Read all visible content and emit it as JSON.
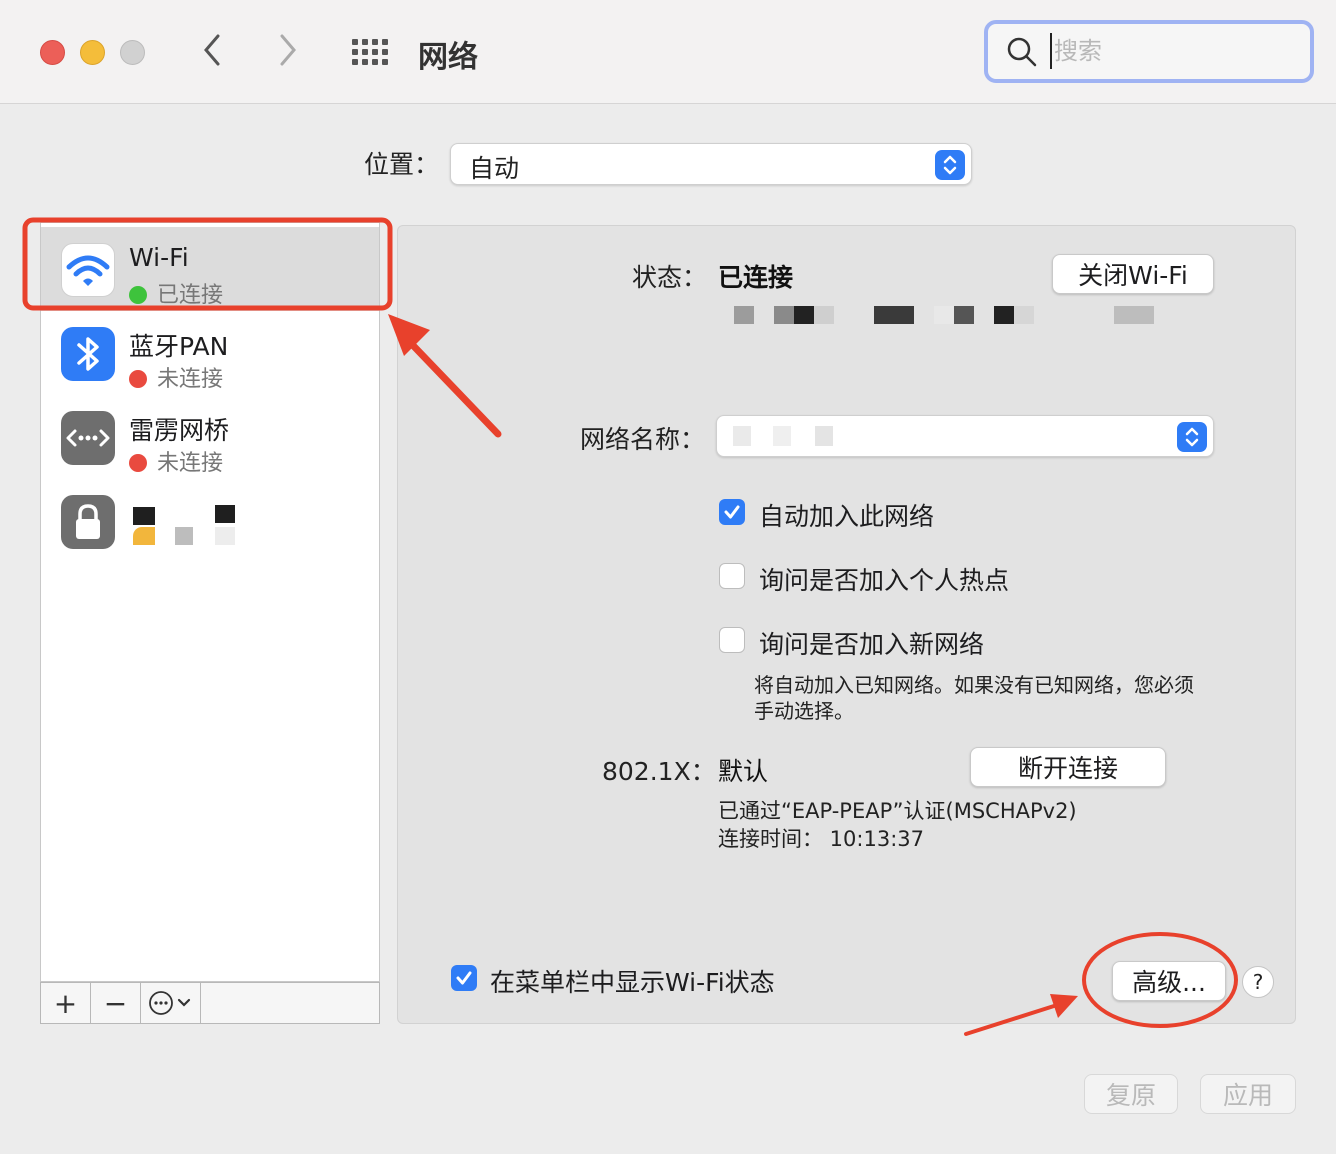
{
  "window": {
    "title": "网络"
  },
  "search": {
    "placeholder": "搜索",
    "value": ""
  },
  "location": {
    "label": "位置：",
    "value": "自动"
  },
  "sidebar": {
    "items": [
      {
        "name": "Wi-Fi",
        "status": "已连接",
        "status_color": "#3ec33c",
        "icon": "wifi-icon"
      },
      {
        "name": "蓝牙PAN",
        "status": "未连接",
        "status_color": "#e94a3f",
        "icon": "bluetooth-icon"
      },
      {
        "name": "雷雳网桥",
        "status": "未连接",
        "status_color": "#e94a3f",
        "icon": "thunderbolt-bridge-icon"
      },
      {
        "name": "",
        "status": "",
        "icon": "lock-icon"
      }
    ],
    "toolbar": {
      "add": "+",
      "remove": "−",
      "action": "⋯"
    }
  },
  "detail": {
    "status_label": "状态：",
    "status_value": "已连接",
    "toggle_wifi": "关闭Wi-Fi",
    "network_name_label": "网络名称：",
    "network_name_value": "",
    "auto_join": {
      "label": "自动加入此网络",
      "checked": true
    },
    "ask_hotspot": {
      "label": "询问是否加入个人热点",
      "checked": false
    },
    "ask_new": {
      "label": "询问是否加入新网络",
      "checked": false
    },
    "note_line1": "将自动加入已知网络。如果没有已知网络，您必须",
    "note_line2": "手动选择。",
    "dot1x_label": "802.1X：",
    "dot1x_value": "默认",
    "disconnect": "断开连接",
    "auth_line": "已通过“EAP-PEAP”认证(MSCHAPv2)",
    "conn_time_line": "连接时间：  10:13:37",
    "show_menubar": {
      "label": "在菜单栏中显示Wi-Fi状态",
      "checked": true
    },
    "advanced": "高级...",
    "help": "?"
  },
  "footer": {
    "revert": "复原",
    "apply": "应用"
  },
  "colors": {
    "accent": "#2f7cf6",
    "annotation": "#e8412c"
  }
}
